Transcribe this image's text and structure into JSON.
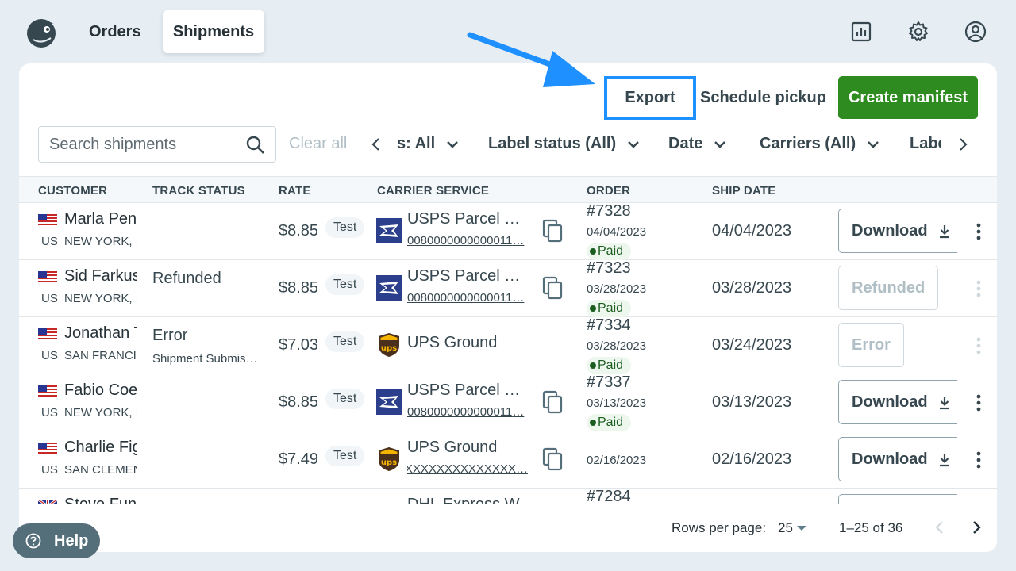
{
  "nav": {
    "orders": "Orders",
    "shipments": "Shipments",
    "icons": [
      "reports-icon",
      "gear-icon",
      "account-icon"
    ]
  },
  "toolbar": {
    "export": "Export",
    "schedule_pickup": "Schedule pickup",
    "create_manifest": "Create manifest"
  },
  "filters": {
    "search_placeholder": "Search shipments",
    "clear_all": "Clear all",
    "items": [
      "s: All",
      "Label status (All)",
      "Date",
      "Carriers (All)",
      "Labe"
    ]
  },
  "table": {
    "headers": [
      "CUSTOMER",
      "TRACK STATUS",
      "RATE",
      "CARRIER SERVICE",
      "ORDER",
      "SHIP DATE"
    ],
    "rows": [
      {
        "name": "Marla Penn",
        "country": "US",
        "city": "NEW YORK, NY",
        "track": "",
        "track_sub": "",
        "rate": "$8.85",
        "badge": "Test",
        "service": "USPS Parcel Select",
        "tracking": "…0080000000000011",
        "order": "#7328",
        "order_date": "04/04/2023",
        "payment": "Paid",
        "ship_date": "04/04/2023",
        "action": "Download"
      },
      {
        "name": "Sid Farkus",
        "country": "US",
        "city": "NEW YORK, NY",
        "track": "Refunded",
        "track_sub": "",
        "rate": "$8.85",
        "badge": "Test",
        "service": "USPS Parcel Select",
        "tracking": "…0080000000000011",
        "order": "#7323",
        "order_date": "03/28/2023",
        "payment": "Paid",
        "ship_date": "03/28/2023",
        "action": "Refunded"
      },
      {
        "name": "Jonathan T",
        "country": "US",
        "city": "SAN FRANCISCO",
        "track": "Error",
        "track_sub": "Shipment Submission",
        "rate": "$7.03",
        "badge": "Test",
        "service": "UPS Ground",
        "tracking": "",
        "order": "#7334",
        "order_date": "03/28/2023",
        "payment": "Paid",
        "ship_date": "03/24/2023",
        "action": "Error"
      },
      {
        "name": "Fabio Coel",
        "country": "US",
        "city": "NEW YORK, NY",
        "track": "",
        "track_sub": "",
        "rate": "$8.85",
        "badge": "Test",
        "service": "USPS Parcel Select",
        "tracking": "…0080000000000011",
        "order": "#7337",
        "order_date": "03/13/2023",
        "payment": "Paid",
        "ship_date": "03/13/2023",
        "action": "Download"
      },
      {
        "name": "Charlie Fig",
        "country": "US",
        "city": "SAN CLEMENTE",
        "track": "",
        "track_sub": "",
        "rate": "$7.49",
        "badge": "Test",
        "service": "UPS Ground",
        "tracking": "…XXXXXXXXXXXXXXX",
        "order": "",
        "order_date": "02/16/2023",
        "payment": "",
        "ship_date": "02/16/2023",
        "action": "Download"
      },
      {
        "name": "Steve Fung",
        "country": "",
        "city": "",
        "track": "",
        "track_sub": "",
        "rate": "",
        "badge": "",
        "service": "DHL Express W",
        "tracking": "",
        "order": "#7284",
        "order_date": "",
        "payment": "",
        "ship_date": "",
        "action": ""
      }
    ]
  },
  "pagination": {
    "rows_per_page_label": "Rows per page:",
    "rows_per_page": "25",
    "range": "1–25 of 36"
  },
  "help": "Help",
  "colors": {
    "accent": "#2e8b1f",
    "highlight": "#1e90ff",
    "paid": "#1b5e20"
  }
}
